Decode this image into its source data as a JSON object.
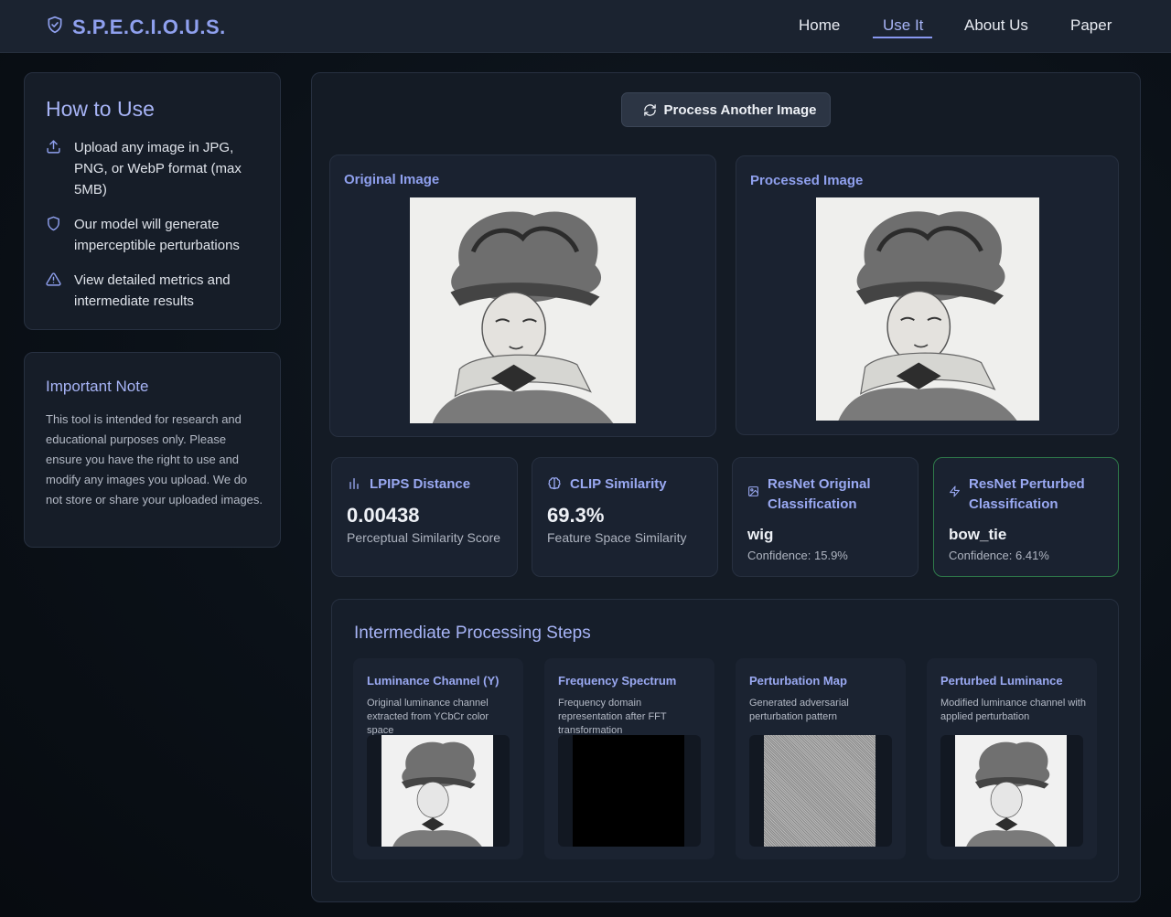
{
  "nav": {
    "brand": "S.P.E.C.I.O.U.S.",
    "links": [
      "Home",
      "Use It",
      "About Us",
      "Paper"
    ],
    "active": "Use It"
  },
  "how_to_use": {
    "title": "How to Use",
    "steps": [
      {
        "icon": "upload-icon",
        "text": "Upload any image in JPG, PNG, or WebP format (max 5MB)"
      },
      {
        "icon": "shield-icon",
        "text": "Our model will generate imperceptible perturbations"
      },
      {
        "icon": "warning-triangle-icon",
        "text": "View detailed metrics and intermediate results"
      }
    ]
  },
  "important_note": {
    "title": "Important Note",
    "text": "This tool is intended for research and educational purposes only. Please ensure you have the right to use and modify any images you upload. We do not store or share your uploaded images."
  },
  "process_button": "Process Another Image",
  "original_image": {
    "label": "Original Image"
  },
  "processed_image": {
    "label": "Processed Image"
  },
  "metrics": {
    "lpips": {
      "title": "LPIPS Distance",
      "value": "0.00438",
      "caption": "Perceptual Similarity Score",
      "icon": "bar-chart-icon"
    },
    "clip": {
      "title": "CLIP Similarity",
      "value": "69.3%",
      "caption": "Feature Space Similarity",
      "icon": "brain-icon"
    },
    "resnet_original": {
      "title": "ResNet Original Classification",
      "label": "wig",
      "confidence": "Confidence: 15.9%",
      "icon": "image-icon"
    },
    "resnet_perturbed": {
      "title": "ResNet Perturbed Classification",
      "label": "bow_tie",
      "confidence": "Confidence: 6.41%",
      "icon": "lightning-icon"
    }
  },
  "intermediate": {
    "title": "Intermediate Processing Steps",
    "steps": [
      {
        "title": "Luminance Channel (Y)",
        "desc": "Original luminance channel extracted from YCbCr color space"
      },
      {
        "title": "Frequency Spectrum",
        "desc": "Frequency domain representation after FFT transformation"
      },
      {
        "title": "Perturbation Map",
        "desc": "Generated adversarial perturbation pattern"
      },
      {
        "title": "Perturbed Luminance",
        "desc": "Modified luminance channel with applied perturbation"
      }
    ]
  },
  "colors": {
    "accent": "#8fa0ee",
    "highlight_border": "#2f7a4a"
  }
}
